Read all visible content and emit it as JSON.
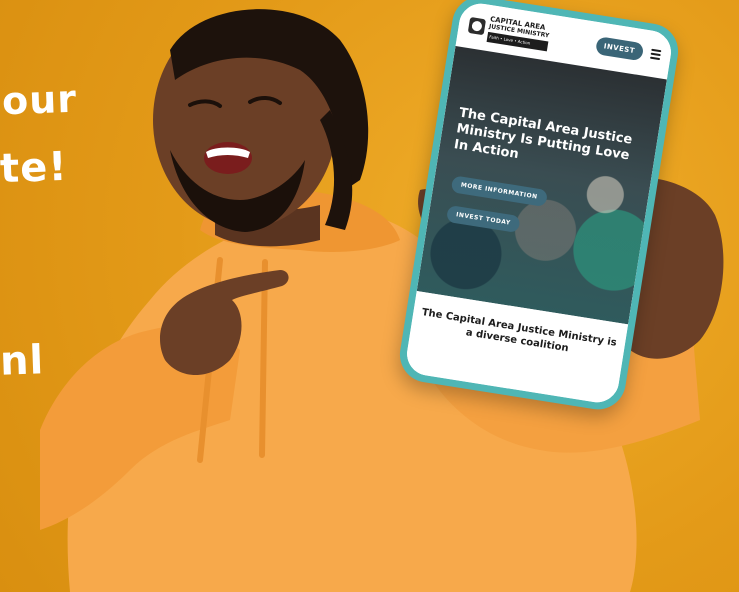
{
  "overlay_text": {
    "line1": "our",
    "line2": "te!",
    "line3": "nl"
  },
  "phone": {
    "logo": {
      "line1": "CAPITAL AREA",
      "line2": "JUSTICE MINISTRY",
      "tagline": "Faith • Love • Action"
    },
    "header": {
      "invest_label": "INVEST"
    },
    "hero": {
      "title": "The Capital Area Justice Ministry Is Putting Love In Action",
      "buttons": [
        {
          "label": "MORE INFORMATION"
        },
        {
          "label": "INVEST TODAY"
        }
      ]
    },
    "below": {
      "text": "The Capital Area Justice Ministry is a diverse coalition"
    }
  },
  "colors": {
    "background": "#e9a31f",
    "phone_frame": "#4fb6b5",
    "button": "#3e6a7c",
    "hoodie": "#f5a84a"
  }
}
